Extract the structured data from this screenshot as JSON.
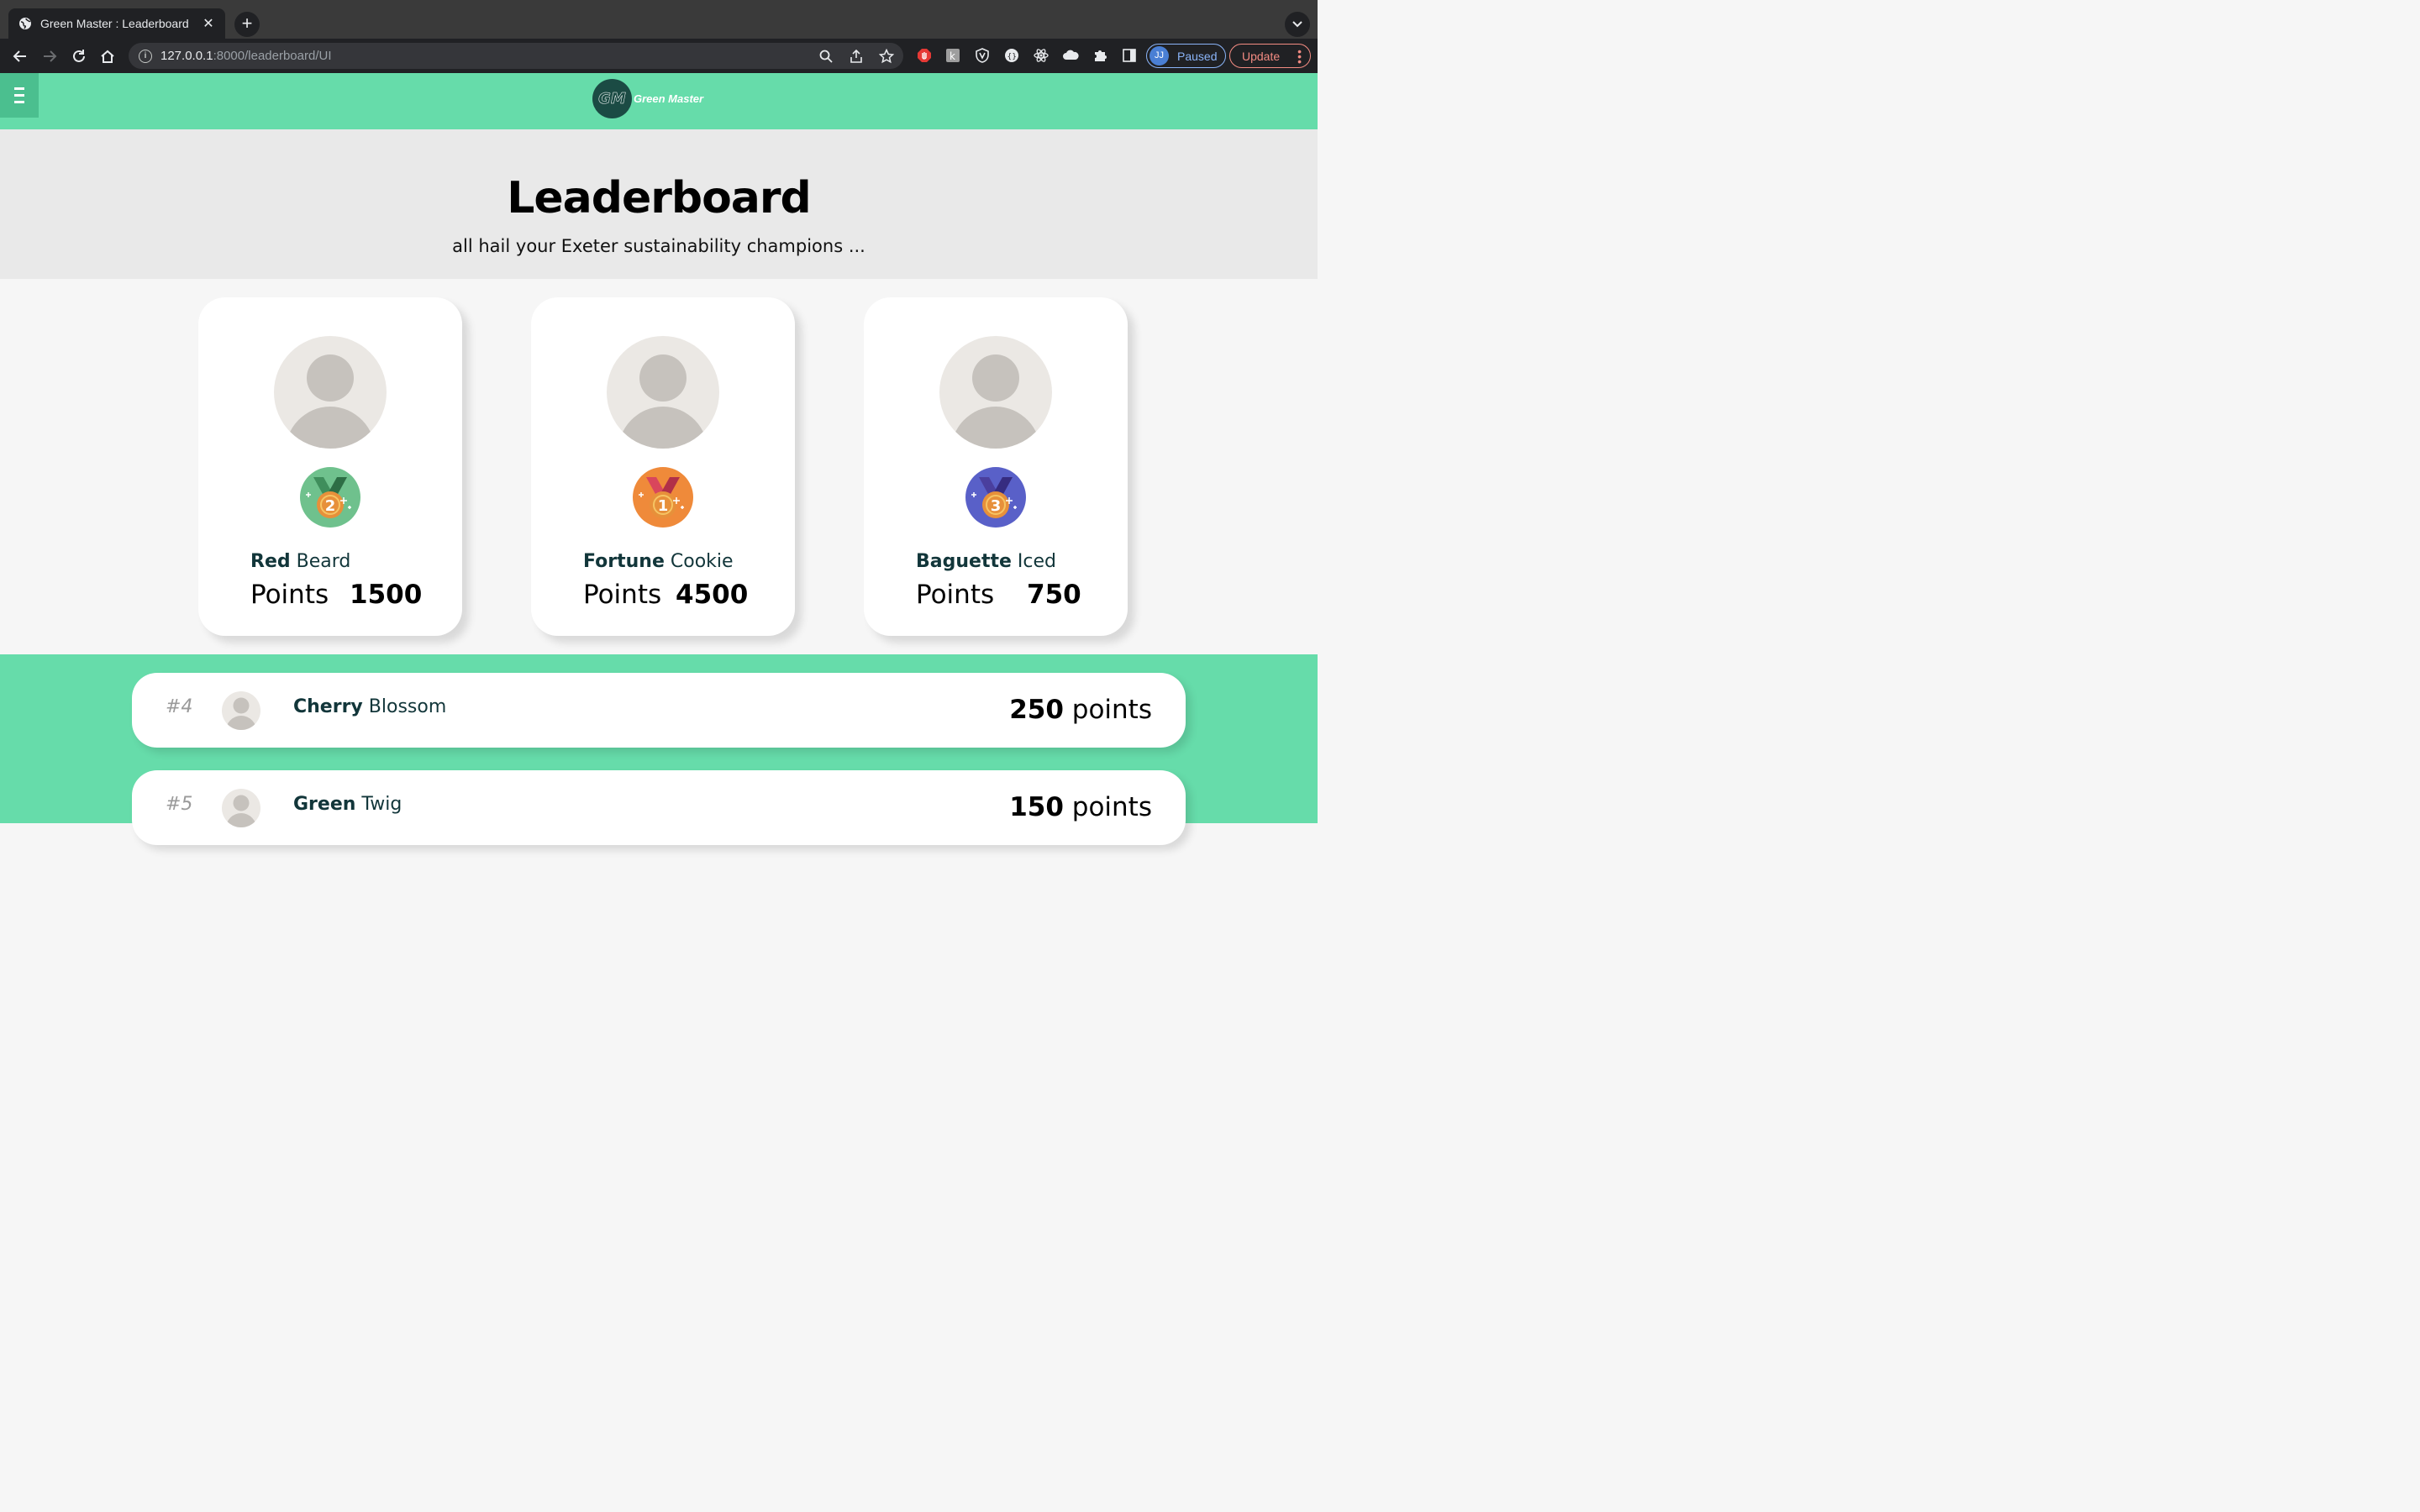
{
  "browser": {
    "tab_title": "Green Master : Leaderboard",
    "url_host": "127.0.0.1",
    "url_path": ":8000/leaderboard/UI",
    "profile_initials": "JJ",
    "profile_label": "Paused",
    "update_label": "Update"
  },
  "site": {
    "logo_badge": "GM",
    "logo_text": "Green Master",
    "brand_color": "#66dcaa"
  },
  "hero": {
    "title": "Leaderboard",
    "subtitle": "all hail your Exeter sustainability champions ..."
  },
  "podium": [
    {
      "rank": "2",
      "first_name": "Red",
      "last_name": "Beard",
      "points_label": "Points",
      "points": "1500",
      "medal_color": "#6fc18d",
      "medal_icon": "medal-2-icon"
    },
    {
      "rank": "1",
      "first_name": "Fortune",
      "last_name": "Cookie",
      "points_label": "Points",
      "points": "4500",
      "medal_color": "#ef8a3a",
      "medal_icon": "medal-1-icon"
    },
    {
      "rank": "3",
      "first_name": "Baguette",
      "last_name": "Iced",
      "points_label": "Points",
      "points": "750",
      "medal_color": "#5960c8",
      "medal_icon": "medal-3-icon"
    }
  ],
  "rows": [
    {
      "rank": "#4",
      "first_name": "Cherry",
      "last_name": "Blossom",
      "points": "250",
      "unit": "points"
    },
    {
      "rank": "#5",
      "first_name": "Green",
      "last_name": "Twig",
      "points": "150",
      "unit": "points"
    }
  ]
}
